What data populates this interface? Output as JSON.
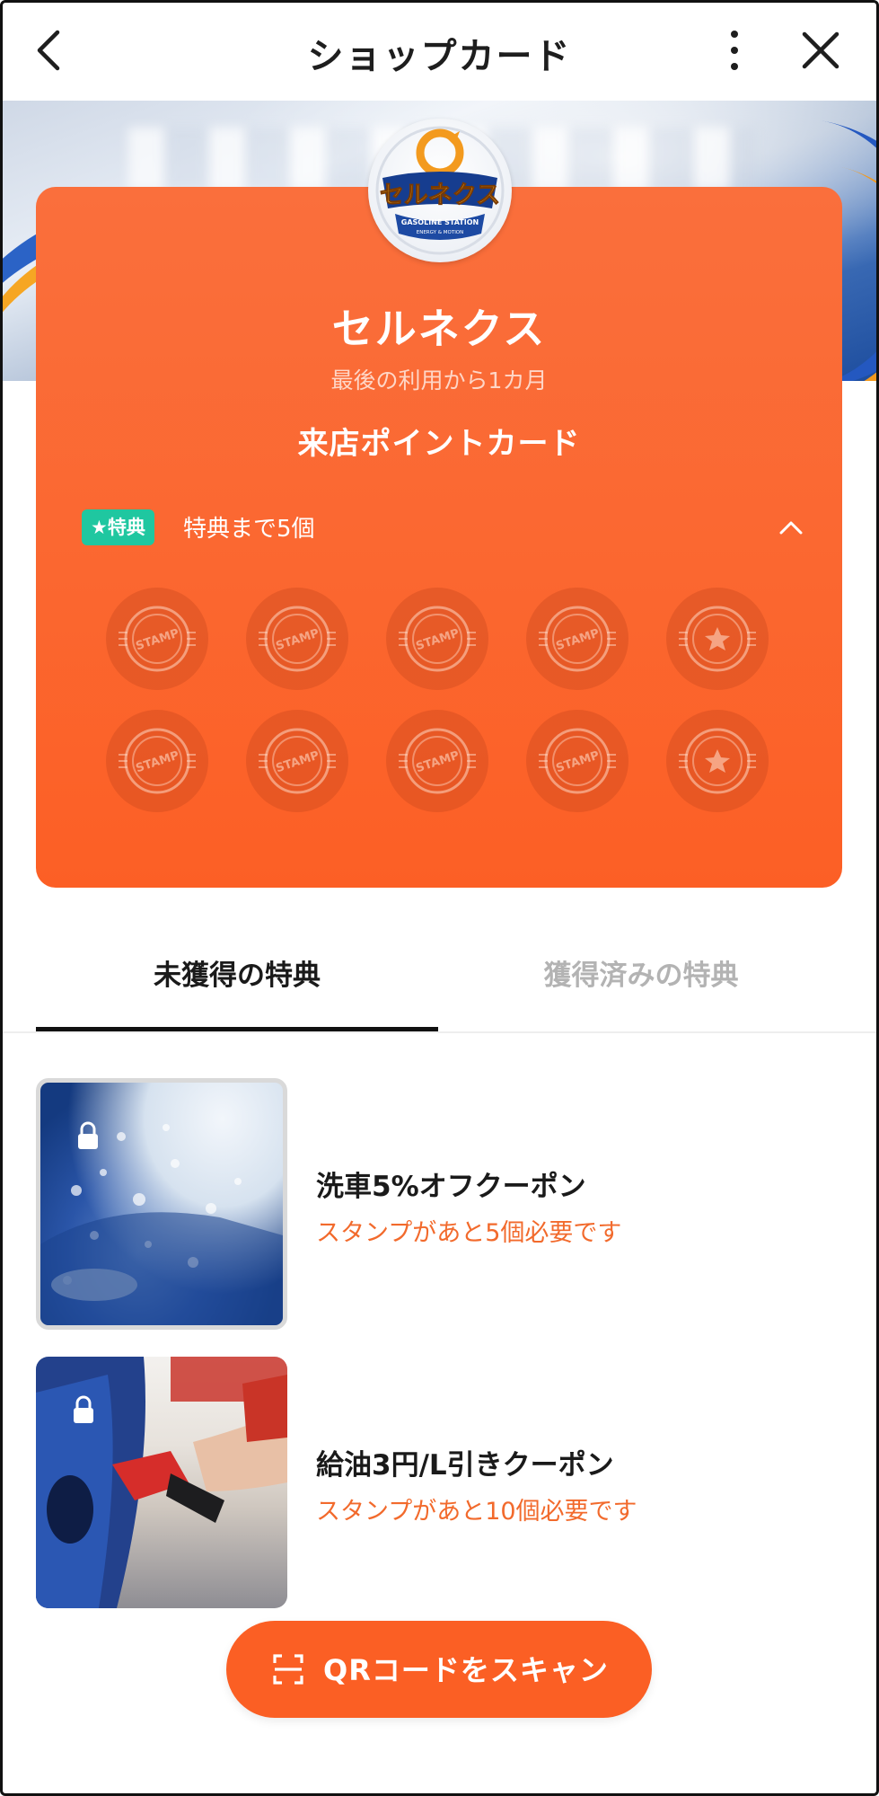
{
  "header": {
    "title": "ショップカード",
    "back_icon": "chevron-left-icon",
    "more_icon": "more-vertical-icon",
    "close_icon": "close-icon"
  },
  "card": {
    "logo": {
      "brand_text": "セルネクス",
      "sub_text": "GASOLINE STATION",
      "tagline": "ENERGY & MOTION"
    },
    "shop_name": "セルネクス",
    "last_used": "最後の利用から1カ月",
    "card_title": "来店ポイントカード",
    "reward_badge": "★特典",
    "reward_remaining": "特典まで5個",
    "stamps_total": 10,
    "stamps_collected": 0,
    "stamp_label": "STAMP",
    "reward_stamp_positions": [
      5,
      10
    ],
    "colors": {
      "card": "#fb6730",
      "badge": "#1fc7a0"
    }
  },
  "tabs": [
    {
      "label": "未獲得の特典",
      "active": true
    },
    {
      "label": "獲得済みの特典",
      "active": false
    }
  ],
  "coupons": [
    {
      "title": "洗車5%オフクーポン",
      "requirement": "スタンプがあと5個必要です",
      "locked": true,
      "image": "car-wash-photo"
    },
    {
      "title": "給油3円/L引きクーポン",
      "requirement": "スタンプがあと10個必要です",
      "locked": true,
      "image": "refueling-photo"
    }
  ],
  "scan_button": {
    "label": "QRコードをスキャン",
    "icon": "qr-scan-icon"
  },
  "accent_color": "#f26a2c"
}
